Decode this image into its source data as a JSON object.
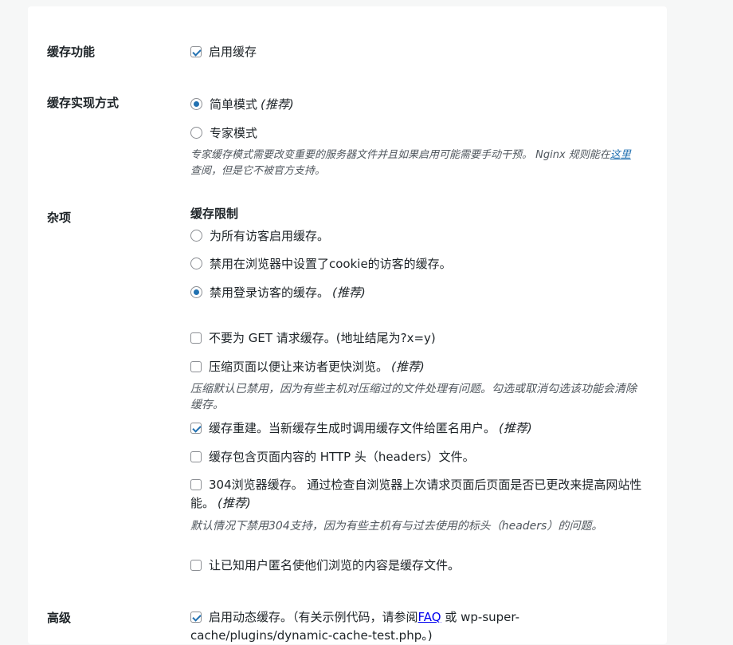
{
  "sections": {
    "cache_function": {
      "label": "缓存功能",
      "enable_cache": {
        "label": "启用缓存",
        "checked": true
      }
    },
    "cache_method": {
      "label": "缓存实现方式",
      "simple_mode": {
        "label": "简单模式",
        "recommended": "(推荐)",
        "selected": true
      },
      "expert_mode": {
        "label": "专家模式",
        "selected": false
      },
      "description_1": "专家缓存模式需要改变重要的服务器文件并且如果启用可能需要手动干预。 Nginx 规则能在",
      "description_link": "这里",
      "description_2": "查阅，但是它不被官方支持。"
    },
    "misc": {
      "label": "杂项",
      "cache_restrictions": "缓存限制",
      "radio_all": {
        "label": "为所有访客启用缓存。",
        "selected": false
      },
      "radio_cookie": {
        "label": "禁用在浏览器中设置了cookie的访客的缓存。",
        "selected": false
      },
      "radio_logged": {
        "label": "禁用登录访客的缓存。",
        "recommended": "(推荐)",
        "selected": true
      },
      "no_get": {
        "label": "不要为 GET 请求缓存。(地址结尾为?x=y)",
        "checked": false
      },
      "compress": {
        "label": "压缩页面以便让来访者更快浏览。",
        "recommended": "(推荐)",
        "checked": false
      },
      "compress_desc": "压缩默认已禁用，因为有些主机对压缩过的文件处理有问题。勾选或取消勾选该功能会清除缓存。",
      "rebuild": {
        "label": "缓存重建。当新缓存生成时调用缓存文件给匿名用户。",
        "recommended": "(推荐)",
        "checked": true
      },
      "http_headers": {
        "label": "缓存包含页面内容的 HTTP 头（headers）文件。",
        "checked": false
      },
      "browser_304": {
        "label": "304浏览器缓存。 通过检查自浏览器上次请求页面后页面是否已更改来提高网站性能。",
        "recommended": "(推荐)",
        "checked": false
      },
      "browser_304_desc": "默认情况下禁用304支持，因为有些主机有与过去使用的标头（headers）的问题。",
      "anon_known": {
        "label": "让已知用户匿名使他们浏览的内容是缓存文件。",
        "checked": false
      }
    },
    "advanced": {
      "label": "高级",
      "dynamic_cache": {
        "label_1": "启用动态缓存。（有关示例代码，请参阅",
        "link": "FAQ",
        "label_2": " 或 wp-super-cache/plugins/dynamic-cache-test.php。)",
        "checked": true
      }
    }
  },
  "colors": {
    "accent": "#2271b1",
    "background": "#f6f7f7",
    "panel": "#ffffff",
    "text": "#1d2327",
    "muted": "#50575e"
  }
}
